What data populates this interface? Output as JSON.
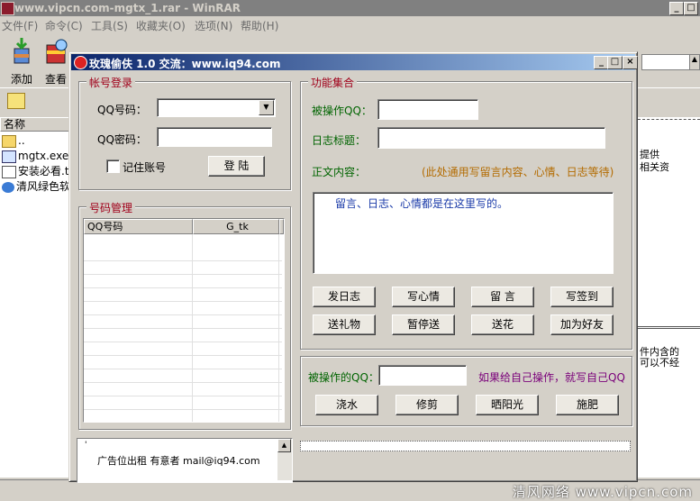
{
  "winrar": {
    "title": "www.vipcn.com-mgtx_1.rar - WinRAR",
    "menu": [
      "文件(F)",
      "命令(C)",
      "工具(S)",
      "收藏夹(O)",
      "选项(N)",
      "帮助(H)"
    ],
    "toolbar": {
      "add": "添加",
      "view": "查看"
    },
    "file_header": "名称",
    "files": [
      "..",
      "mgtx.exe",
      "安装必看.t",
      "清风绿色软"
    ],
    "right_text": [
      "提供",
      "相关资",
      "件内含的",
      "可以不经"
    ],
    "watermark": "清风网络 www.vipcn.com"
  },
  "dialog": {
    "title": "玫瑰偷伕 1.0  交流：www.iq94.com",
    "login": {
      "group": "帐号登录",
      "qq_label": "QQ号码：",
      "pwd_label": "QQ密码：",
      "remember": "记住账号",
      "login_btn": "登 陆"
    },
    "manage": {
      "group": "号码管理",
      "col1": "QQ号码",
      "col2": "G_tk"
    },
    "ad": "广告位出租 有意者 mail@iq94.com",
    "func": {
      "group": "功能集合",
      "target_label": "被操作QQ：",
      "diary_title_label": "日志标题：",
      "body_label": "正文内容：",
      "body_hint": "(此处通用写留言内容、心情、日志等待)",
      "body_text": "留言、日志、心情都是在这里写的。",
      "buttons_row1": [
        "发日志",
        "写心情",
        "留 言",
        "写签到"
      ],
      "buttons_row2": [
        "送礼物",
        "暂停送",
        "送花",
        "加为好友"
      ]
    },
    "garden": {
      "target_label": "被操作的QQ：",
      "hint": "如果给自己操作，就写自己QQ",
      "buttons": [
        "浇水",
        "修剪",
        "晒阳光",
        "施肥"
      ]
    }
  },
  "colors": {
    "title_start": "#0a246a",
    "title_end": "#a6caf0",
    "group_label": "#a0001a"
  }
}
